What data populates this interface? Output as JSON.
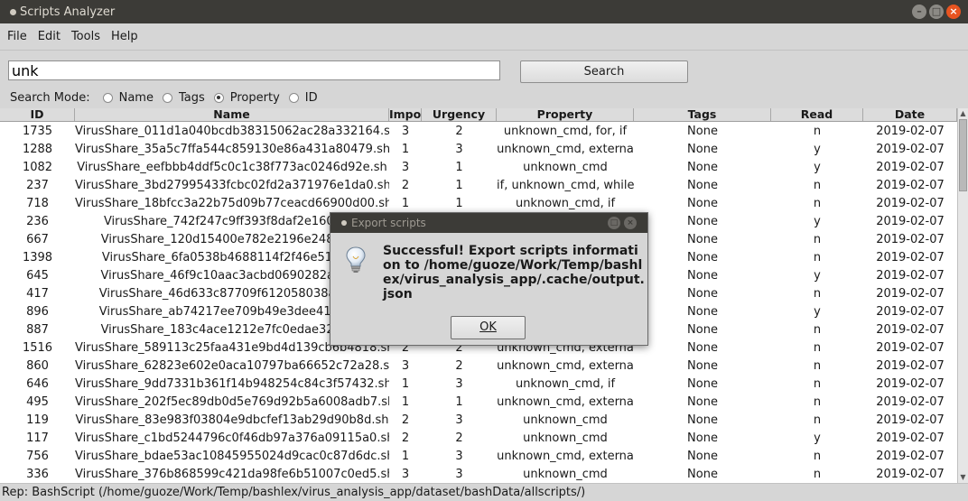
{
  "window": {
    "title": "Scripts Analyzer"
  },
  "menu": [
    "File",
    "Edit",
    "Tools",
    "Help"
  ],
  "search": {
    "value": "unk",
    "button_label": "Search"
  },
  "search_mode": {
    "label": "Search Mode:",
    "options": [
      {
        "label": "Name",
        "checked": false
      },
      {
        "label": "Tags",
        "checked": false
      },
      {
        "label": "Property",
        "checked": true
      },
      {
        "label": "ID",
        "checked": false
      }
    ]
  },
  "table": {
    "columns": [
      "ID",
      "Name",
      "Impo",
      "Urgency",
      "Property",
      "Tags",
      "Read",
      "Date"
    ],
    "rows": [
      [
        "1735",
        "VirusShare_011d1a040bcdb38315062ac28a332164.sh",
        "3",
        "2",
        "unknown_cmd, for, if",
        "None",
        "n",
        "2019-02-07"
      ],
      [
        "1288",
        "VirusShare_35a5c7ffa544c859130e86a431a80479.sh",
        "1",
        "3",
        "unknown_cmd, externa",
        "None",
        "y",
        "2019-02-07"
      ],
      [
        "1082",
        "VirusShare_eefbbb4ddf5c0c1c38f773ac0246d92e.sh",
        "3",
        "1",
        "unknown_cmd",
        "None",
        "y",
        "2019-02-07"
      ],
      [
        "237",
        "VirusShare_3bd27995433fcbc02fd2a371976e1da0.sh",
        "2",
        "1",
        "if, unknown_cmd, while",
        "None",
        "n",
        "2019-02-07"
      ],
      [
        "718",
        "VirusShare_18bfcc3a22b75d09b77ceacd66900d00.sh",
        "1",
        "1",
        "unknown_cmd, if",
        "None",
        "n",
        "2019-02-07"
      ],
      [
        "236",
        "VirusShare_742f247c9ff393f8daf2e1609f0d",
        "",
        "",
        "",
        "None",
        "y",
        "2019-02-07"
      ],
      [
        "667",
        "VirusShare_120d15400e782e2196e2488bed",
        "",
        "",
        "",
        "None",
        "n",
        "2019-02-07"
      ],
      [
        "1398",
        "VirusShare_6fa0538b4688114f2f46e51661d",
        "",
        "",
        "",
        "None",
        "n",
        "2019-02-07"
      ],
      [
        "645",
        "VirusShare_46f9c10aac3acbd0690282a0eed",
        "",
        "",
        "",
        "None",
        "y",
        "2019-02-07"
      ],
      [
        "417",
        "VirusShare_46d633c87709f612058038a1a14",
        "",
        "",
        "",
        "None",
        "n",
        "2019-02-07"
      ],
      [
        "896",
        "VirusShare_ab74217ee709b49e3dee412f9b0",
        "",
        "",
        "",
        "None",
        "y",
        "2019-02-07"
      ],
      [
        "887",
        "VirusShare_183c4ace1212e7fc0edae3287e9",
        "",
        "",
        "",
        "None",
        "n",
        "2019-02-07"
      ],
      [
        "1516",
        "VirusShare_589113c25faa431e9bd4d139cb6b4818.sh",
        "2",
        "2",
        "unknown_cmd, externa",
        "None",
        "n",
        "2019-02-07"
      ],
      [
        "860",
        "VirusShare_62823e602e0aca10797ba66652c72a28.sh",
        "3",
        "2",
        "unknown_cmd, externa",
        "None",
        "n",
        "2019-02-07"
      ],
      [
        "646",
        "VirusShare_9dd7331b361f14b948254c84c3f57432.sh",
        "1",
        "3",
        "unknown_cmd, if",
        "None",
        "n",
        "2019-02-07"
      ],
      [
        "495",
        "VirusShare_202f5ec89db0d5e769d92b5a6008adb7.sh",
        "1",
        "1",
        "unknown_cmd, externa",
        "None",
        "n",
        "2019-02-07"
      ],
      [
        "119",
        "VirusShare_83e983f03804e9dbcfef13ab29d90b8d.sh",
        "2",
        "3",
        "unknown_cmd",
        "None",
        "n",
        "2019-02-07"
      ],
      [
        "117",
        "VirusShare_c1bd5244796c0f46db97a376a09115a0.sh",
        "2",
        "2",
        "unknown_cmd",
        "None",
        "y",
        "2019-02-07"
      ],
      [
        "756",
        "VirusShare_bdae53ac10845955024d9cac0c87d6dc.sh",
        "1",
        "3",
        "unknown_cmd, externa",
        "None",
        "n",
        "2019-02-07"
      ],
      [
        "336",
        "VirusShare_376b868599c421da98fe6b51007c0ed5.sh",
        "3",
        "3",
        "unknown_cmd",
        "None",
        "n",
        "2019-02-07"
      ]
    ]
  },
  "status": "Rep: BashScript (/home/guoze/Work/Temp/bashlex/virus_analysis_app/dataset/bashData/allscripts/)",
  "dialog": {
    "title": "Export scripts",
    "message": "Successful! Export scripts information to /home/guoze/Work/Temp/bashlex/virus_analysis_app/.cache/output.json",
    "ok_label": "OK"
  },
  "icons": {
    "window": "app-dot-icon",
    "dialog": "lightbulb-icon"
  },
  "colors": {
    "titlebar": "#3c3b37",
    "close_button": "#e95420"
  }
}
